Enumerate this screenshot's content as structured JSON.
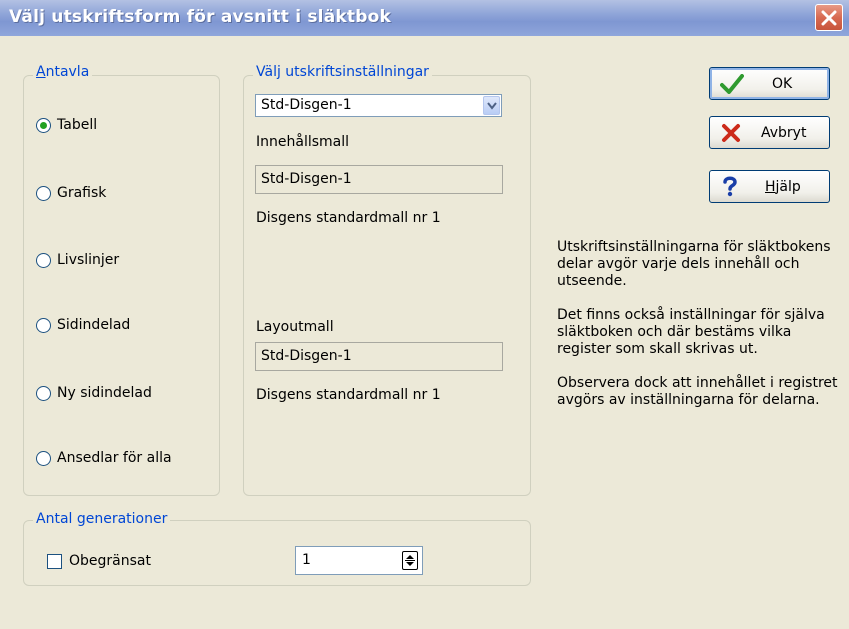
{
  "window": {
    "title": "Välj utskriftsform för avsnitt i släktbok"
  },
  "antavla": {
    "legend_first": "A",
    "legend_rest": "ntavla",
    "options": [
      {
        "label": "Tabell",
        "selected": true
      },
      {
        "label": "Grafisk",
        "selected": false
      },
      {
        "label": "Livslinjer",
        "selected": false
      },
      {
        "label": "Sidindelad",
        "selected": false
      },
      {
        "label": "Ny sidindelad",
        "selected": false
      },
      {
        "label": "Ansedlar för alla",
        "selected": false
      }
    ]
  },
  "settings": {
    "legend": "Välj utskriftsinställningar",
    "selected_value": "Std-Disgen-1",
    "content_label": "Innehållsmall",
    "content_value": "Std-Disgen-1",
    "content_desc": "Disgens standardmall nr 1",
    "layout_label": "Layoutmall",
    "layout_value": "Std-Disgen-1",
    "layout_desc": "Disgens standardmall nr 1"
  },
  "generations": {
    "legend": "Antal generationer",
    "unlimited_label": "Obegränsat",
    "unlimited_checked": false,
    "count_value": "1"
  },
  "buttons": {
    "ok": "OK",
    "cancel": "Avbryt",
    "help_first": "H",
    "help_rest": "jälp"
  },
  "info": {
    "p1": "Utskriftsinställningarna för släktbokens delar avgör varje dels innehåll och utseende.",
    "p2": "Det finns också inställningar för själva släktboken och där bestäms vilka register som skall skrivas ut.",
    "p3": "Observera dock att innehållet i registret avgörs av inställningarna för delarna."
  },
  "colors": {
    "accent_blue": "#0046d5",
    "title_bar": "#8ea4d8",
    "dialog_bg": "#ece9d8"
  }
}
